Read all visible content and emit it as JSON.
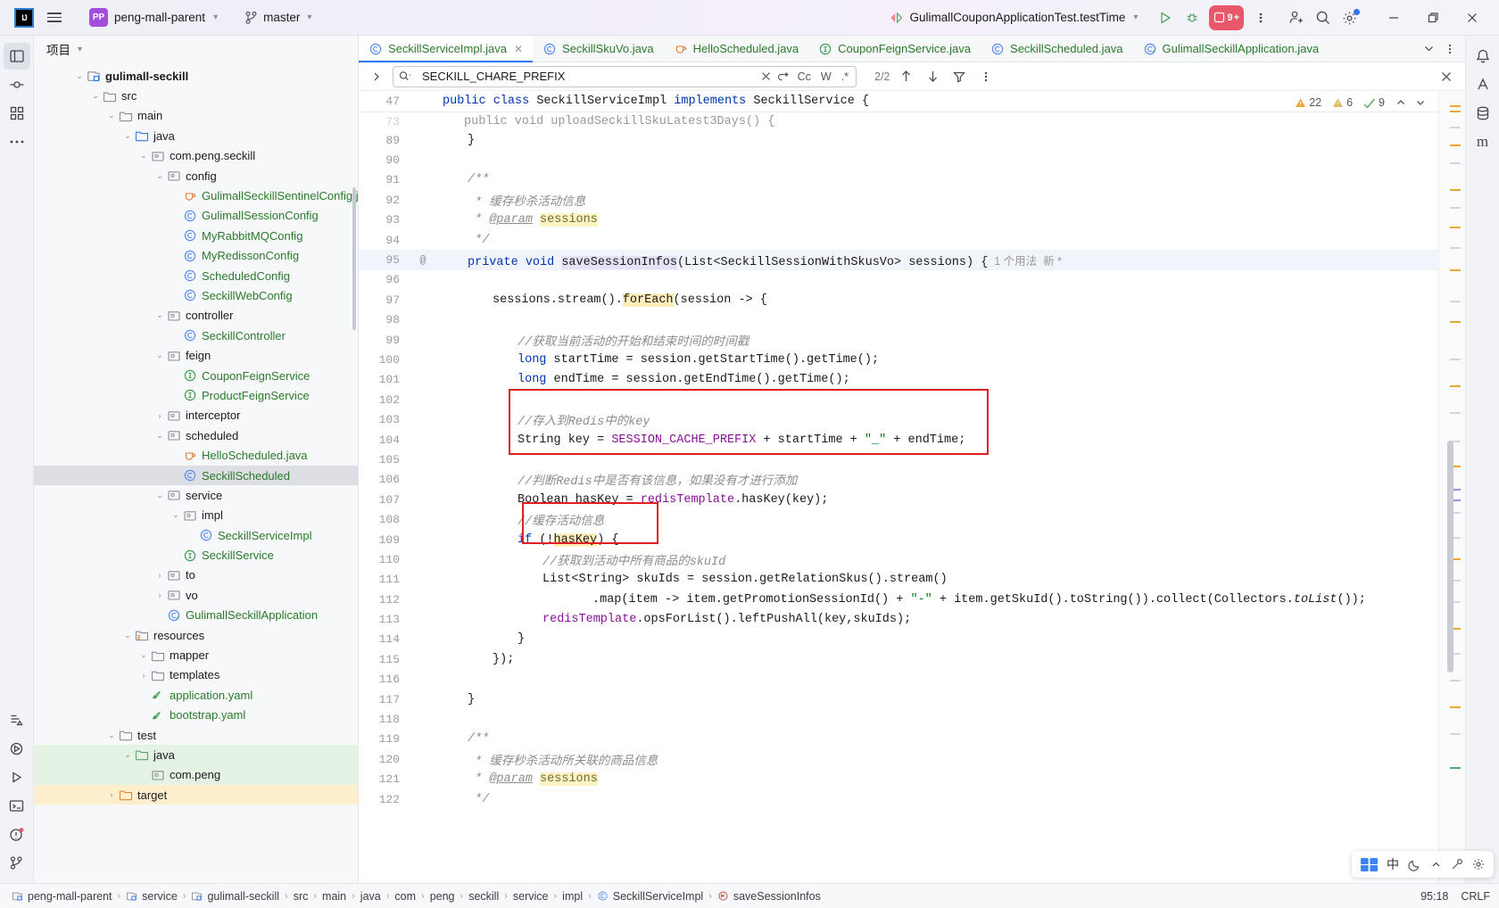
{
  "titlebar": {
    "logo": "IJ",
    "project_badge": "PP",
    "project_name": "peng-mall-parent",
    "branch": "master",
    "run_config": "GulimallCouponApplicationTest.testTime",
    "notification_count": "9",
    "notification_suffix": "+",
    "icons": {
      "hamburger": "main-menu-icon",
      "run": "run-icon",
      "debug": "debug-icon",
      "more": "more-vertical-icon",
      "account": "add-account-icon",
      "search": "search-everywhere-icon",
      "settings": "settings-gear-icon",
      "minimize": "minimize-icon",
      "maximize": "maximize-icon",
      "close": "close-icon"
    }
  },
  "project_panel": {
    "title": "项目",
    "tree": [
      {
        "depth": 2,
        "arrow": "v",
        "icon": "module",
        "label": "gulimall-seckill",
        "style": "bold"
      },
      {
        "depth": 3,
        "arrow": "v",
        "icon": "folder",
        "label": "src",
        "style": "dir"
      },
      {
        "depth": 4,
        "arrow": "v",
        "icon": "folder",
        "label": "main",
        "style": "dir"
      },
      {
        "depth": 5,
        "arrow": "v",
        "icon": "srcroot",
        "label": "java",
        "style": "dir"
      },
      {
        "depth": 6,
        "arrow": "v",
        "icon": "package",
        "label": "com.peng.seckill",
        "style": "dir"
      },
      {
        "depth": 7,
        "arrow": "v",
        "icon": "package",
        "label": "config",
        "style": "dir"
      },
      {
        "depth": 8,
        "arrow": "",
        "icon": "java",
        "label": "GulimallSeckillSentinelConfig.jav",
        "style": "file"
      },
      {
        "depth": 8,
        "arrow": "",
        "icon": "class",
        "label": "GulimallSessionConfig",
        "style": "file"
      },
      {
        "depth": 8,
        "arrow": "",
        "icon": "class",
        "label": "MyRabbitMQConfig",
        "style": "file"
      },
      {
        "depth": 8,
        "arrow": "",
        "icon": "class",
        "label": "MyRedissonConfig",
        "style": "file"
      },
      {
        "depth": 8,
        "arrow": "",
        "icon": "class",
        "label": "ScheduledConfig",
        "style": "file"
      },
      {
        "depth": 8,
        "arrow": "",
        "icon": "class",
        "label": "SeckillWebConfig",
        "style": "file"
      },
      {
        "depth": 7,
        "arrow": "v",
        "icon": "package",
        "label": "controller",
        "style": "dir"
      },
      {
        "depth": 8,
        "arrow": "",
        "icon": "class",
        "label": "SeckillController",
        "style": "file"
      },
      {
        "depth": 7,
        "arrow": "v",
        "icon": "package",
        "label": "feign",
        "style": "dir"
      },
      {
        "depth": 8,
        "arrow": "",
        "icon": "iface",
        "label": "CouponFeignService",
        "style": "file"
      },
      {
        "depth": 8,
        "arrow": "",
        "icon": "iface",
        "label": "ProductFeignService",
        "style": "file"
      },
      {
        "depth": 7,
        "arrow": ">",
        "icon": "package",
        "label": "interceptor",
        "style": "dir"
      },
      {
        "depth": 7,
        "arrow": "v",
        "icon": "package",
        "label": "scheduled",
        "style": "dir"
      },
      {
        "depth": 8,
        "arrow": "",
        "icon": "java",
        "label": "HelloScheduled.java",
        "style": "file"
      },
      {
        "depth": 8,
        "arrow": "",
        "icon": "class",
        "label": "SeckillScheduled",
        "style": "file",
        "row": "sel"
      },
      {
        "depth": 7,
        "arrow": "v",
        "icon": "package",
        "label": "service",
        "style": "dir"
      },
      {
        "depth": 8,
        "arrow": "v",
        "icon": "package",
        "label": "impl",
        "style": "dir"
      },
      {
        "depth": 9,
        "arrow": "",
        "icon": "class",
        "label": "SeckillServiceImpl",
        "style": "file"
      },
      {
        "depth": 8,
        "arrow": "",
        "icon": "iface",
        "label": "SeckillService",
        "style": "file"
      },
      {
        "depth": 7,
        "arrow": ">",
        "icon": "package",
        "label": "to",
        "style": "dir"
      },
      {
        "depth": 7,
        "arrow": ">",
        "icon": "package",
        "label": "vo",
        "style": "dir"
      },
      {
        "depth": 7,
        "arrow": "",
        "icon": "springapp",
        "label": "GulimallSeckillApplication",
        "style": "file"
      },
      {
        "depth": 5,
        "arrow": "v",
        "icon": "resroot",
        "label": "resources",
        "style": "dir"
      },
      {
        "depth": 6,
        "arrow": "v",
        "icon": "folder",
        "label": "mapper",
        "style": "dir"
      },
      {
        "depth": 6,
        "arrow": ">",
        "icon": "folder",
        "label": "templates",
        "style": "dir"
      },
      {
        "depth": 6,
        "arrow": "",
        "icon": "yaml",
        "label": "application.yaml",
        "style": "file"
      },
      {
        "depth": 6,
        "arrow": "",
        "icon": "yaml",
        "label": "bootstrap.yaml",
        "style": "file"
      },
      {
        "depth": 4,
        "arrow": "v",
        "icon": "folder",
        "label": "test",
        "style": "dir"
      },
      {
        "depth": 5,
        "arrow": "v",
        "icon": "testroot",
        "label": "java",
        "style": "dir",
        "row": "green"
      },
      {
        "depth": 6,
        "arrow": "",
        "icon": "package",
        "label": "com.peng",
        "style": "dir",
        "row": "green"
      },
      {
        "depth": 4,
        "arrow": ">",
        "icon": "target",
        "label": "target",
        "style": "dir",
        "row": "orange"
      }
    ]
  },
  "tabs": [
    {
      "label": "SeckillServiceImpl.java",
      "icon": "class",
      "active": true,
      "closable": true
    },
    {
      "label": "SeckillSkuVo.java",
      "icon": "class",
      "active": false,
      "closable": false
    },
    {
      "label": "HelloScheduled.java",
      "icon": "java",
      "active": false,
      "closable": false
    },
    {
      "label": "CouponFeignService.java",
      "icon": "iface",
      "active": false,
      "closable": false
    },
    {
      "label": "SeckillScheduled.java",
      "icon": "class",
      "active": false,
      "closable": false
    },
    {
      "label": "GulimallSeckillApplication.java",
      "icon": "springapp",
      "active": false,
      "closable": false
    }
  ],
  "find": {
    "value": "SECKILL_CHARE_PREFIX",
    "placeholder": "Search",
    "match_count": "2/2",
    "toggle_case": "Cc",
    "toggle_words": "W",
    "toggle_regex": ".*",
    "icons": {
      "expand": "chevron-right-icon",
      "search": "search-dropdown-icon",
      "clear": "clear-icon",
      "history": "search-history-icon",
      "filter": "filter-icon",
      "more": "more-options-icon",
      "prev": "arrow-up-icon",
      "next": "arrow-down-icon",
      "close": "close-find-icon"
    }
  },
  "inspection": {
    "warnings": "22",
    "weak_warnings": "6",
    "typos": "9"
  },
  "sticky_line": {
    "number": "47",
    "code": "public class SeckillServiceImpl implements SeckillService {"
  },
  "editor": {
    "ghost_line": {
      "number": "73",
      "code": "public void uploadSeckillSkuLatest3Days() {"
    },
    "lines": [
      {
        "n": "89",
        "indent": 1,
        "tokens": [
          {
            "t": "}",
            "c": ""
          }
        ]
      },
      {
        "n": "90",
        "indent": 0,
        "tokens": []
      },
      {
        "n": "91",
        "indent": 1,
        "tokens": [
          {
            "t": "/**",
            "c": "cmt"
          }
        ]
      },
      {
        "n": "92",
        "indent": 1,
        "tokens": [
          {
            "t": " * 缓存秒杀活动信息",
            "c": "cmt"
          }
        ]
      },
      {
        "n": "93",
        "indent": 1,
        "tokens": [
          {
            "t": " * ",
            "c": "cmt"
          },
          {
            "t": "@param",
            "c": "cmt-u"
          },
          {
            "t": " ",
            "c": "cmt"
          },
          {
            "t": "sessions",
            "c": "param"
          }
        ]
      },
      {
        "n": "94",
        "indent": 1,
        "tokens": [
          {
            "t": " */",
            "c": "cmt"
          }
        ]
      },
      {
        "n": "95",
        "indent": 1,
        "mark": "@",
        "current": true,
        "tokens": [
          {
            "t": "private ",
            "c": "kw"
          },
          {
            "t": "void ",
            "c": "kw"
          },
          {
            "t": "saveSessionInfos",
            "c": "hl2"
          },
          {
            "t": "(List<SeckillSessionWithSkusVo> sessions) {",
            "c": ""
          },
          {
            "t": "  1 个用法  新 *",
            "c": "usage"
          }
        ]
      },
      {
        "n": "96",
        "indent": 0,
        "tokens": []
      },
      {
        "n": "97",
        "indent": 2,
        "tokens": [
          {
            "t": "sessions.stream().",
            "c": ""
          },
          {
            "t": "forEach",
            "c": "hl"
          },
          {
            "t": "(session -> {",
            "c": ""
          }
        ]
      },
      {
        "n": "98",
        "indent": 0,
        "tokens": []
      },
      {
        "n": "99",
        "indent": 3,
        "tokens": [
          {
            "t": "//获取当前活动的开始和结束时间的时间戳",
            "c": "cmt"
          }
        ]
      },
      {
        "n": "100",
        "indent": 3,
        "tokens": [
          {
            "t": "long ",
            "c": "kw"
          },
          {
            "t": "startTime = session.getStartTime().getTime();",
            "c": ""
          }
        ]
      },
      {
        "n": "101",
        "indent": 3,
        "tokens": [
          {
            "t": "long ",
            "c": "kw"
          },
          {
            "t": "endTime = session.getEndTime().getTime();",
            "c": ""
          }
        ]
      },
      {
        "n": "102",
        "indent": 0,
        "tokens": []
      },
      {
        "n": "103",
        "indent": 3,
        "tokens": [
          {
            "t": "//存入到Redis中的key",
            "c": "cmt"
          }
        ]
      },
      {
        "n": "104",
        "indent": 3,
        "tokens": [
          {
            "t": "String key = ",
            "c": ""
          },
          {
            "t": "SESSION_CACHE_PREFIX",
            "c": "cnst"
          },
          {
            "t": " + startTime + ",
            "c": ""
          },
          {
            "t": "\"_\"",
            "c": "str"
          },
          {
            "t": " + endTime;",
            "c": ""
          }
        ]
      },
      {
        "n": "105",
        "indent": 0,
        "tokens": []
      },
      {
        "n": "106",
        "indent": 3,
        "tokens": [
          {
            "t": "//判断Redis中是否有该信息，如果没有才进行添加",
            "c": "cmt"
          }
        ]
      },
      {
        "n": "107",
        "indent": 3,
        "tokens": [
          {
            "t": "Boolean hasKey = ",
            "c": ""
          },
          {
            "t": "redisTemplate",
            "c": "fld"
          },
          {
            "t": ".hasKey(key);",
            "c": ""
          }
        ]
      },
      {
        "n": "108",
        "indent": 3,
        "tokens": [
          {
            "t": "//缓存活动信息",
            "c": "cmt"
          }
        ]
      },
      {
        "n": "109",
        "indent": 3,
        "tokens": [
          {
            "t": "if ",
            "c": "kw"
          },
          {
            "t": "(!",
            "c": ""
          },
          {
            "t": "hasKey",
            "c": "hl"
          },
          {
            "t": ") {",
            "c": ""
          }
        ]
      },
      {
        "n": "110",
        "indent": 4,
        "tokens": [
          {
            "t": "//获取到活动中所有商品的skuId",
            "c": "cmt"
          }
        ]
      },
      {
        "n": "111",
        "indent": 4,
        "tokens": [
          {
            "t": "List<String> skuIds = session.getRelationSkus().stream()",
            "c": ""
          }
        ]
      },
      {
        "n": "112",
        "indent": 6,
        "tokens": [
          {
            "t": ".map(item -> item.getPromotionSessionId() + ",
            "c": ""
          },
          {
            "t": "\"-\"",
            "c": "str"
          },
          {
            "t": " + item.getSkuId().toString()).collect(Collectors.",
            "c": ""
          },
          {
            "t": "toList",
            "c": "italic"
          },
          {
            "t": "());",
            "c": ""
          }
        ]
      },
      {
        "n": "113",
        "indent": 4,
        "tokens": [
          {
            "t": "redisTemplate",
            "c": "fld"
          },
          {
            "t": ".opsForList().leftPushAll(key,skuIds);",
            "c": ""
          }
        ]
      },
      {
        "n": "114",
        "indent": 3,
        "tokens": [
          {
            "t": "}",
            "c": ""
          }
        ]
      },
      {
        "n": "115",
        "indent": 2,
        "tokens": [
          {
            "t": "});",
            "c": ""
          }
        ]
      },
      {
        "n": "116",
        "indent": 0,
        "tokens": []
      },
      {
        "n": "117",
        "indent": 1,
        "tokens": [
          {
            "t": "}",
            "c": ""
          }
        ]
      },
      {
        "n": "118",
        "indent": 0,
        "tokens": []
      },
      {
        "n": "119",
        "indent": 1,
        "tokens": [
          {
            "t": "/**",
            "c": "cmt"
          }
        ]
      },
      {
        "n": "120",
        "indent": 1,
        "tokens": [
          {
            "t": " * 缓存秒杀活动所关联的商品信息",
            "c": "cmt"
          }
        ]
      },
      {
        "n": "121",
        "indent": 1,
        "tokens": [
          {
            "t": " * ",
            "c": "cmt"
          },
          {
            "t": "@param",
            "c": "cmt-u"
          },
          {
            "t": " ",
            "c": "cmt"
          },
          {
            "t": "sessions",
            "c": "param"
          }
        ]
      },
      {
        "n": "122",
        "indent": 1,
        "tokens": [
          {
            "t": " */",
            "c": "cmt"
          }
        ]
      }
    ]
  },
  "annotations": {
    "box1": {
      "label": "redis-key-highlight-box"
    },
    "box2": {
      "label": "has-key-condition-box"
    }
  },
  "statusbar": {
    "breadcrumbs": [
      {
        "label": "peng-mall-parent",
        "icon": "module"
      },
      {
        "label": "service",
        "icon": "module"
      },
      {
        "label": "gulimall-seckill",
        "icon": "module"
      },
      {
        "label": "src",
        "icon": ""
      },
      {
        "label": "main",
        "icon": ""
      },
      {
        "label": "java",
        "icon": ""
      },
      {
        "label": "com",
        "icon": ""
      },
      {
        "label": "peng",
        "icon": ""
      },
      {
        "label": "seckill",
        "icon": ""
      },
      {
        "label": "service",
        "icon": ""
      },
      {
        "label": "impl",
        "icon": ""
      },
      {
        "label": "SeckillServiceImpl",
        "icon": "class"
      },
      {
        "label": "saveSessionInfos",
        "icon": "method"
      }
    ],
    "caret": "95:18",
    "line_sep": "CRLF"
  },
  "ime_tray": {
    "lang": "中",
    "icons": [
      "keyboard-icon",
      "moon-icon",
      "chevron-icon",
      "tools-icon",
      "settings-icon"
    ]
  },
  "colors": {
    "accent_blue": "#3574f0",
    "tab_active_underline": "#3574f0",
    "annotation_red": "#e02020",
    "notification_red": "#e8576a",
    "project_purple": "#a24ddb",
    "green_text": "#2a7a2a",
    "keyword_blue": "#0033b3",
    "string_green": "#067d17",
    "constant_purple": "#871094",
    "comment_gray": "#8c8c8c",
    "highlight_yellow": "#ffeeba"
  }
}
